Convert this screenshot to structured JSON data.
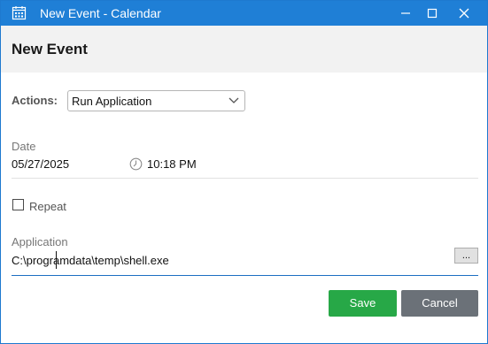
{
  "window": {
    "title": "New Event - Calendar",
    "controls": [
      "minimize",
      "maximize",
      "close"
    ],
    "accent_color": "#1f7fd6"
  },
  "header": {
    "title": "New Event"
  },
  "form": {
    "actions": {
      "label": "Actions:",
      "selected_value": "Run Application"
    },
    "date": {
      "label": "Date",
      "date_value": "05/27/2025",
      "time_value": "10:18 PM"
    },
    "repeat": {
      "label": "Repeat",
      "checked": false
    },
    "application": {
      "label": "Application",
      "value": "C:\\programdata\\temp\\shell.exe",
      "browse_label": "..."
    }
  },
  "footer": {
    "save_label": "Save",
    "cancel_label": "Cancel",
    "save_color": "#27a847",
    "cancel_color": "#6b7178"
  },
  "icons": {
    "app": "calendar-icon",
    "time": "clock-icon",
    "dropdown": "chevron-down-icon"
  }
}
